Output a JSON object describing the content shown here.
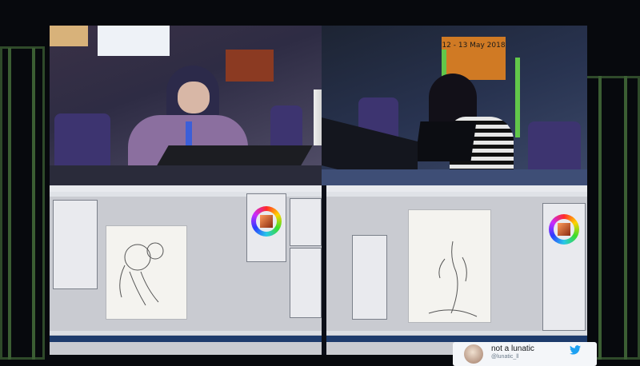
{
  "scene": {
    "description_type": "photo of projection screen showing live drawing competition",
    "left_sign_text": "",
    "right_sign_text": "12 - 13 May 2018"
  },
  "tweet": {
    "user": "not a lunatic",
    "handle": "@lunatic_ll",
    "bird_color": "#1da1f2"
  },
  "colors": {
    "truss": "#3b5e33",
    "chair": "#3d3470",
    "taskbar": "#1d3b6c"
  }
}
